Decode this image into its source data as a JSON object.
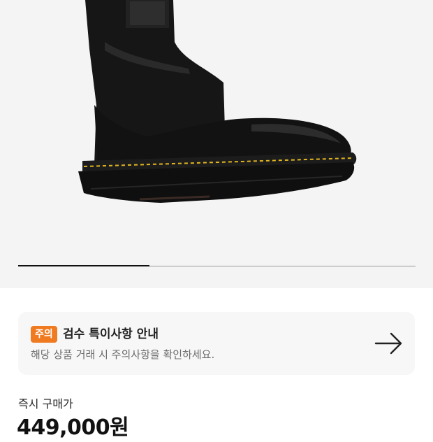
{
  "product": {
    "image_alt": "Black leather pull-on work boot with yellow stitching",
    "gallery_progress_fraction": 0.33
  },
  "notice": {
    "badge": "주의",
    "title": "검수 특이사항 안내",
    "description": "해당 상품 거래 시 주의사항을 확인하세요.",
    "icon": "arrow-right-icon"
  },
  "price": {
    "label": "즉시 구매가",
    "value": "449,000원"
  },
  "colors": {
    "badge": "#f07a1f",
    "hero_background": "#f4f4f5",
    "card_background": "#f7f7f8"
  }
}
